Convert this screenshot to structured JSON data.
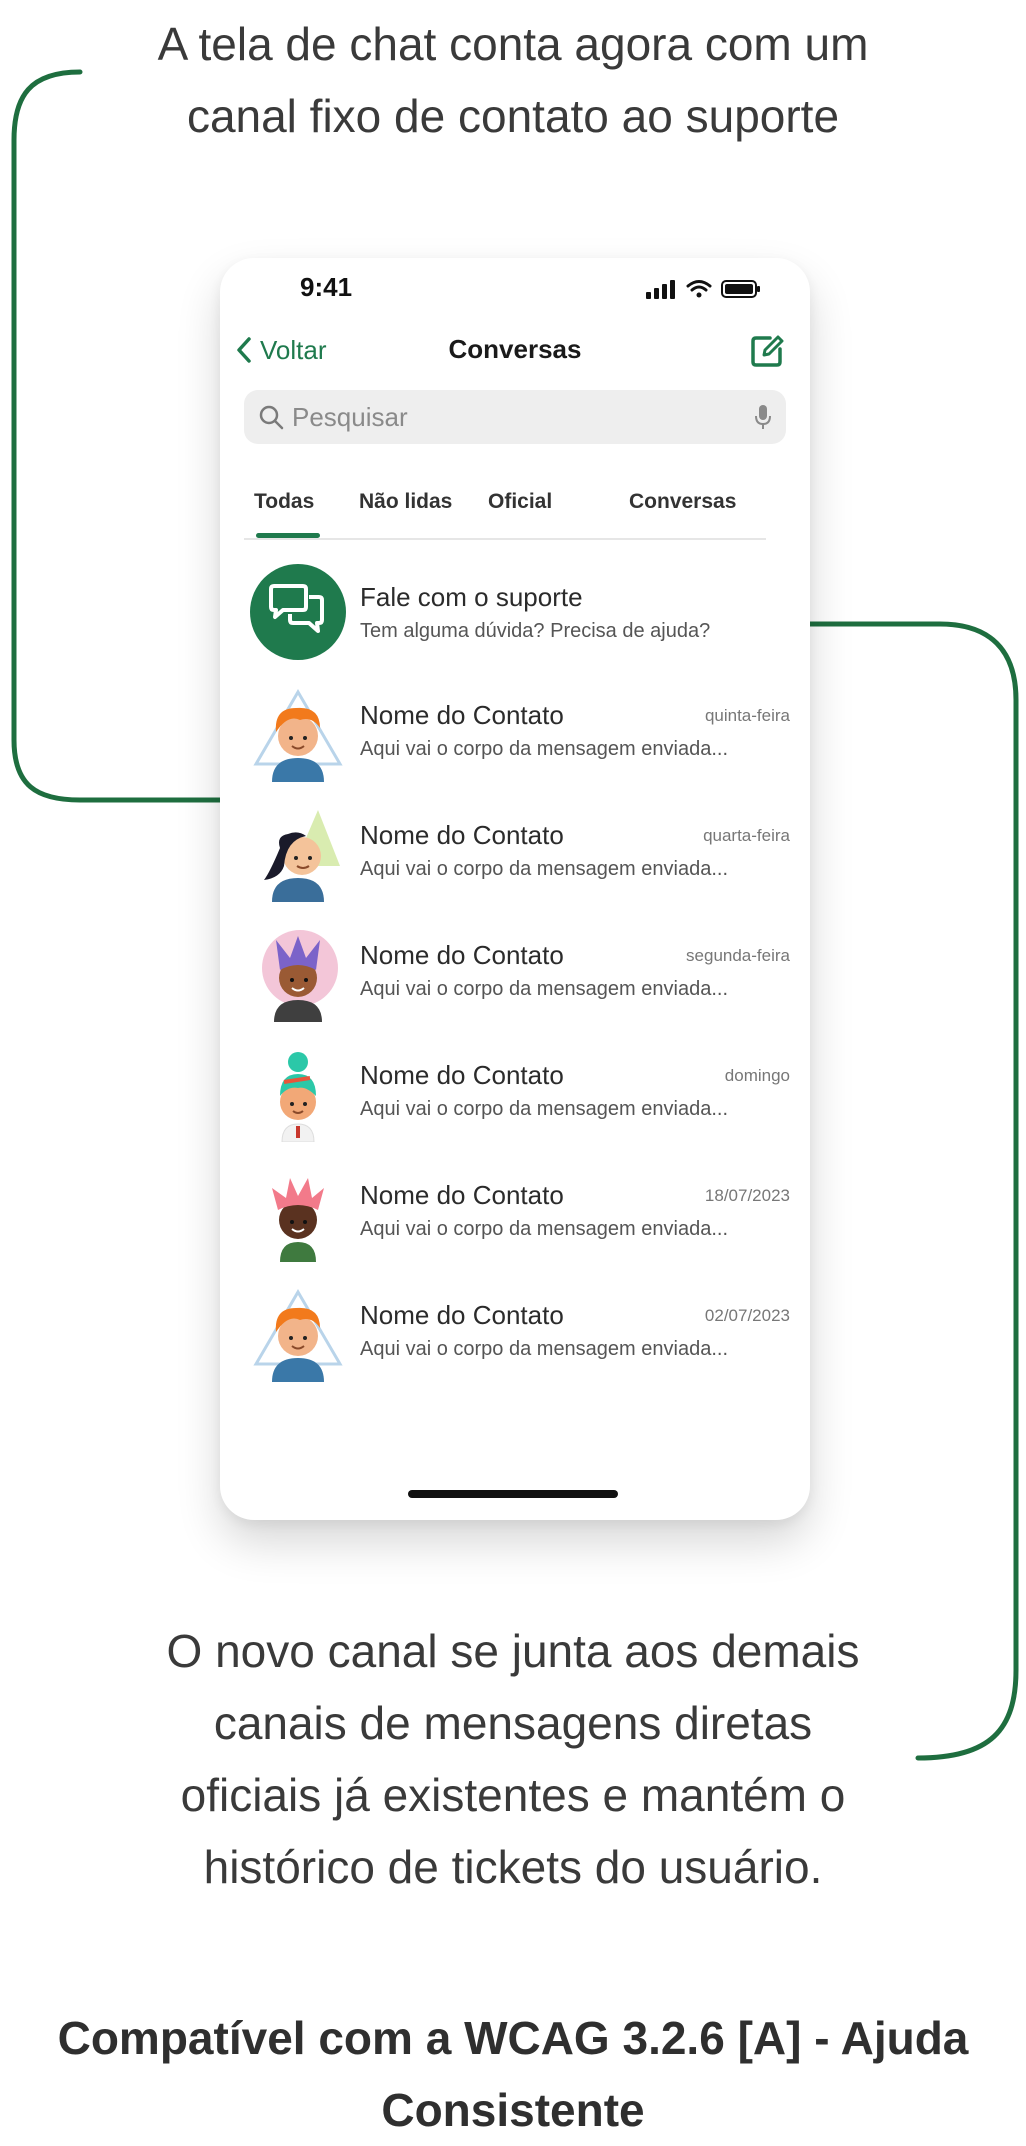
{
  "annotations": {
    "top_line1": "A tela de chat conta agora com um",
    "top_line2": "canal fixo de contato ao suporte",
    "bottom_line1": "O novo canal se junta aos demais",
    "bottom_line2": "canais de mensagens diretas",
    "bottom_line3": "oficiais já existentes e mantém o",
    "bottom_line4": "histórico de tickets do usuário.",
    "footer_line1": "Compatível com a WCAG 3.2.6 [A] - Ajuda",
    "footer_line2": "Consistente"
  },
  "colors": {
    "accent": "#1f7a4d",
    "arrow": "#1e6e3f"
  },
  "status_bar": {
    "time": "9:41"
  },
  "nav": {
    "back_label": "Voltar",
    "title": "Conversas",
    "compose_icon": "compose-icon"
  },
  "search": {
    "placeholder": "Pesquisar"
  },
  "tabs": [
    {
      "label": "Todas",
      "active": true
    },
    {
      "label": "Não lidas",
      "active": false
    },
    {
      "label": "Oficial",
      "active": false
    },
    {
      "label": "Conversas",
      "active": false
    }
  ],
  "support": {
    "name": "Fale com o suporte",
    "subtitle": "Tem alguma dúvida? Precisa de ajuda?",
    "icon": "chat-bubbles-icon"
  },
  "contacts": [
    {
      "name": "Nome do Contato",
      "message": "Aqui vai o corpo da mensagem enviada...",
      "date": "quinta-feira"
    },
    {
      "name": "Nome do Contato",
      "message": "Aqui vai o corpo da mensagem enviada...",
      "date": "quarta-feira"
    },
    {
      "name": "Nome do Contato",
      "message": "Aqui vai o corpo da mensagem enviada...",
      "date": "segunda-feira"
    },
    {
      "name": "Nome do Contato",
      "message": "Aqui vai o corpo da mensagem enviada...",
      "date": "domingo"
    },
    {
      "name": "Nome do Contato",
      "message": "Aqui vai o corpo da mensagem enviada...",
      "date": "18/07/2023"
    },
    {
      "name": "Nome do Contato",
      "message": "Aqui vai o corpo da mensagem enviada...",
      "date": "02/07/2023"
    }
  ]
}
